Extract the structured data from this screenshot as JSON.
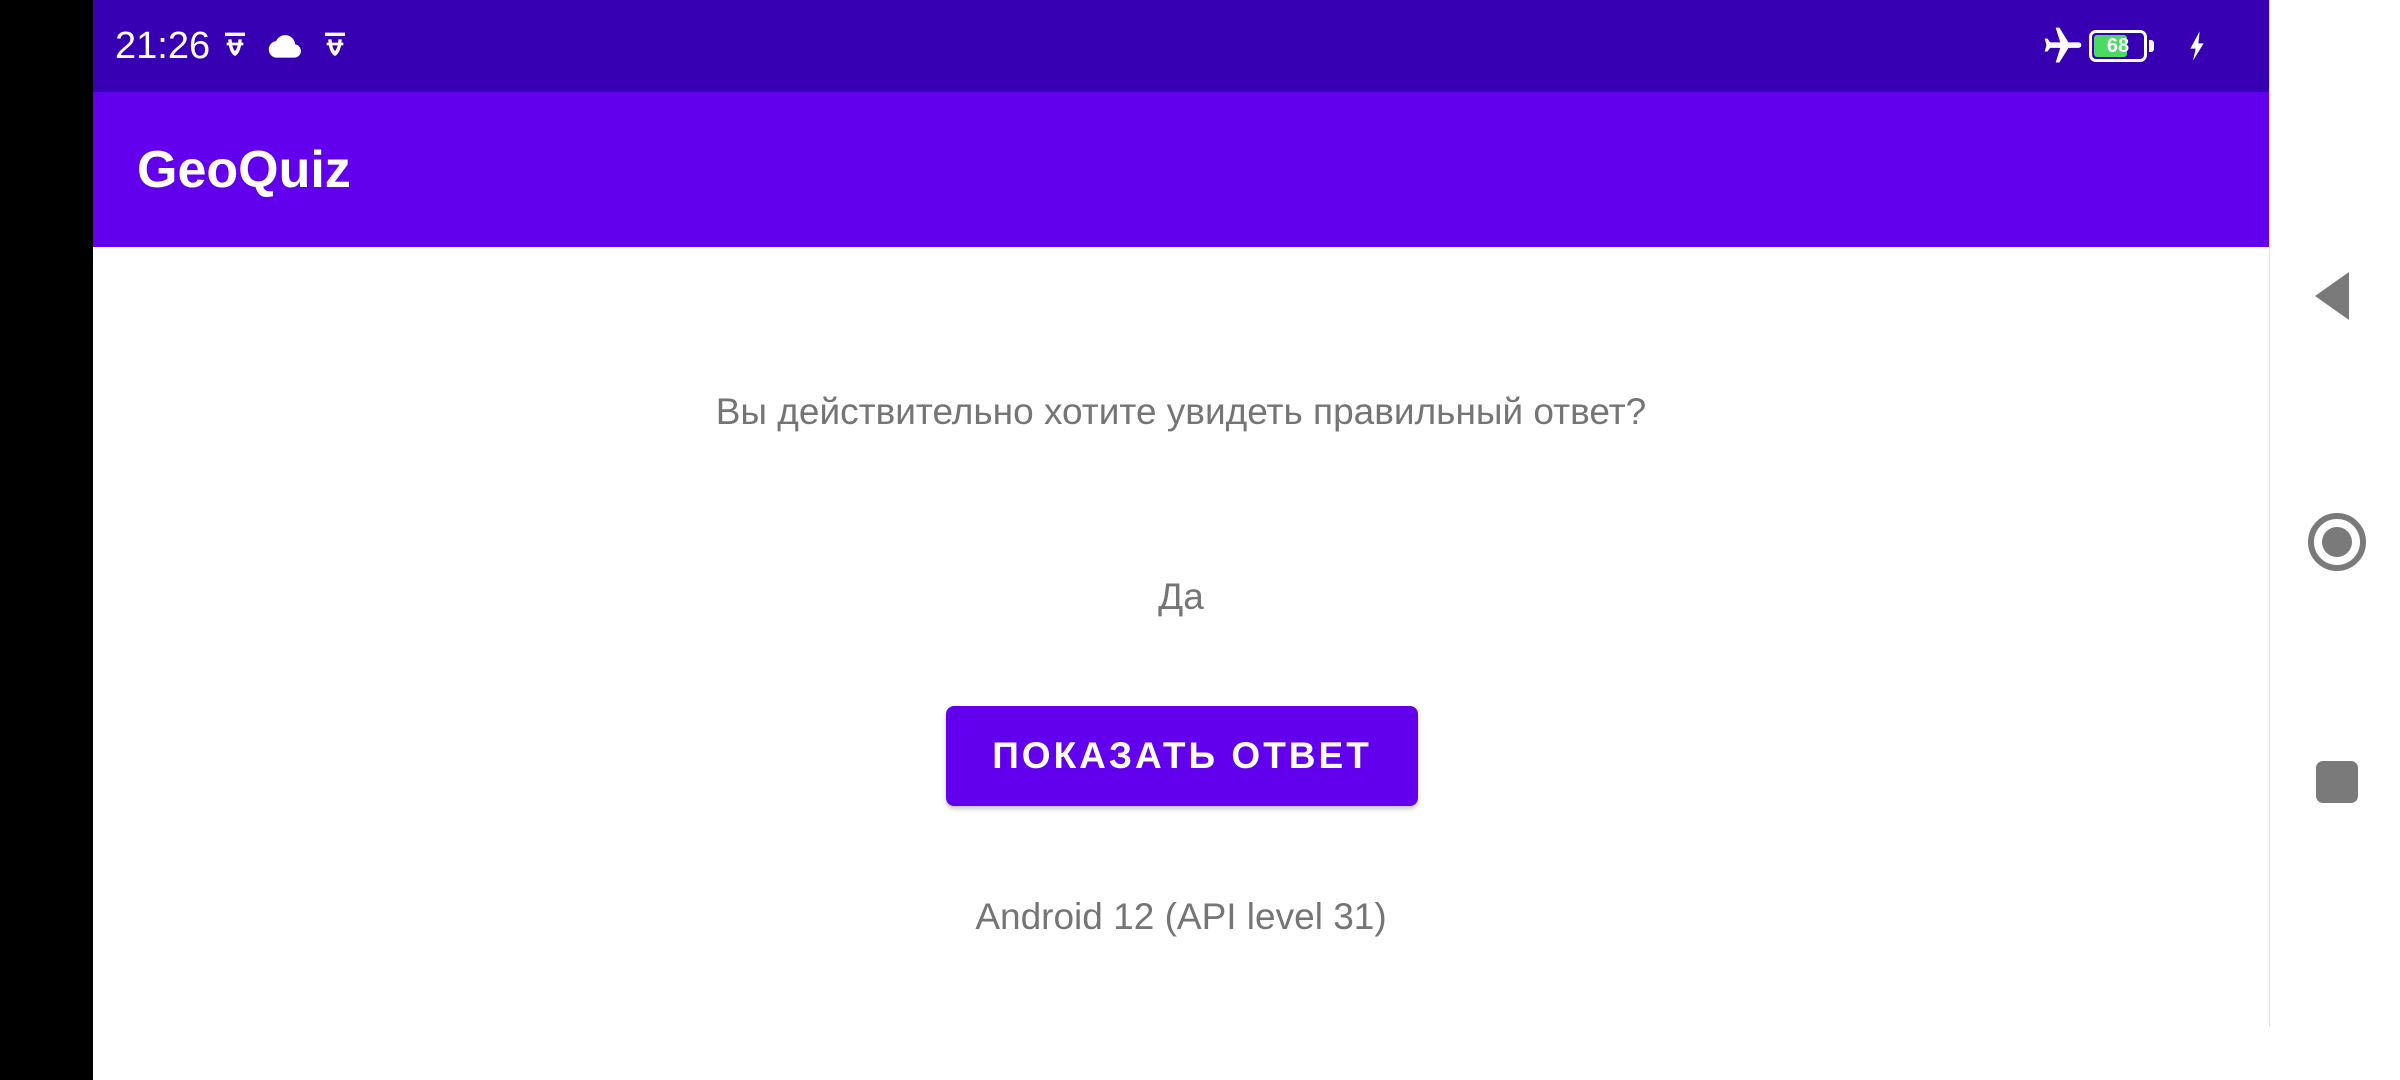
{
  "status_bar": {
    "time": "21:26",
    "battery_level": "68",
    "battery_fraction": 0.68,
    "icons": [
      "notification-icon",
      "cloud-icon",
      "notification-icon",
      "airplane-mode-icon",
      "battery-icon",
      "charging-bolt-icon"
    ]
  },
  "app_bar": {
    "title": "GeoQuiz"
  },
  "content": {
    "question": "Вы действительно хотите увидеть правильный ответ?",
    "answer": "Да",
    "show_answer_label": "ПОКАЗАТЬ ОТВЕТ",
    "api_level": "Android 12 (API level 31)"
  },
  "nav_bar": {
    "buttons": [
      "back-icon",
      "home-icon",
      "recents-icon"
    ]
  },
  "colors": {
    "status_bar": "#3700b3",
    "app_bar": "#6200ee",
    "button": "#6200ee",
    "body_text": "#757575",
    "nav_icons": "#7a7a7a"
  }
}
